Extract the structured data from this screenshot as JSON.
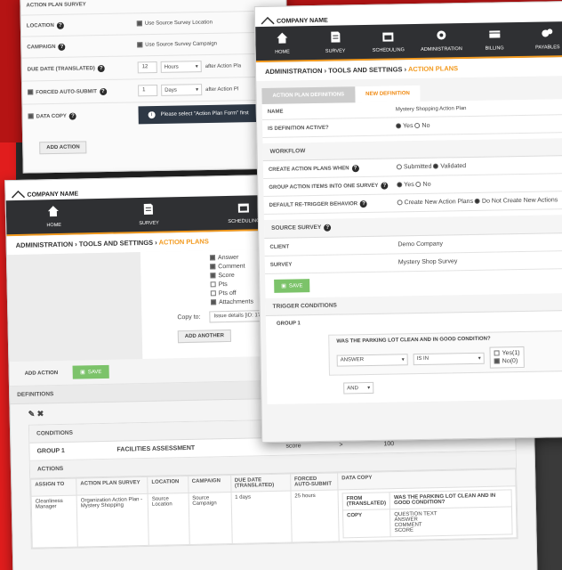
{
  "brand": "COMPANY NAME",
  "nav": [
    "HOME",
    "SURVEY",
    "SCHEDULING",
    "ADMINISTRATION",
    "BILLING",
    "PAYABLES"
  ],
  "nav_icons": [
    "home-icon",
    "survey-icon",
    "calendar-icon",
    "gear-icon",
    "billing-icon",
    "payables-icon"
  ],
  "breadcrumb": {
    "a": "ADMINISTRATION",
    "b": "TOOLS AND SETTINGS",
    "c": "ACTION PLANS",
    "sep": "›"
  },
  "w1": {
    "top_label": "ACTION PLAN SURVEY",
    "location_label": "LOCATION",
    "location_check": "Use Source Survey Location",
    "campaign_label": "CAMPAIGN",
    "campaign_check": "Use Source Survey Campaign",
    "due_label": "DUE DATE (TRANSLATED)",
    "due_value": "12",
    "due_unit": "Hours",
    "due_after": "after Action Pla",
    "forced_label": "FORCED AUTO-SUBMIT",
    "forced_value": "1",
    "forced_unit": "Days",
    "forced_after": "after Action Pl",
    "copy_label": "DATA COPY",
    "info": "Please select \"Action Plan Form\" first",
    "add_action": "ADD ACTION"
  },
  "w2": {
    "checks": [
      "Answer",
      "Comment",
      "Score",
      "Pts",
      "Pts off",
      "Attachments"
    ],
    "copy_to_label": "Copy to:",
    "copy_to_value": "Issue details [ID: 1785]",
    "add_another": "ADD ANOTHER",
    "add_action": "ADD ACTION",
    "save": "SAVE",
    "definitions": "DEFINITIONS",
    "conditions": "CONDITIONS",
    "group": "GROUP 1",
    "group_value": "FACILITIES ASSESSMENT",
    "score_label": "score",
    "score_op": ">",
    "score_val": "100",
    "actions": "ACTIONS",
    "headers": [
      "ASSIGN TO",
      "ACTION PLAN SURVEY",
      "LOCATION",
      "CAMPAIGN",
      "DUE DATE (TRANSLATED)",
      "FORCED AUTO-SUBMIT",
      "DATA COPY"
    ],
    "row": {
      "assign": "Cleanliness Manager",
      "survey": "Organization Action Plan - Mystery Shopping",
      "location": "Source Location",
      "campaign": "Source Campaign",
      "due": "1 days",
      "forced": "25 hours",
      "from_label": "FROM (TRANSLATED)",
      "from_value": "WAS THE PARKING LOT CLEAN AND IN GOOD CONDITION?",
      "copy_label": "COPY",
      "copy_value": "QUESTION TEXT\nANSWER\nCOMMENT\nSCORE"
    }
  },
  "w3": {
    "tab_off": "ACTION PLAN DEFINITIONS",
    "tab_on": "NEW DEFINITION",
    "name_label": "NAME",
    "name_value": "Mystery Shopping Action Plan",
    "active_label": "IS DEFINITION ACTIVE?",
    "yes": "Yes",
    "no": "No",
    "workflow": "WORKFLOW",
    "create_label": "CREATE ACTION PLANS WHEN",
    "submitted": "Submitted",
    "validated": "Validated",
    "group_label": "GROUP ACTION ITEMS INTO ONE SURVEY",
    "retrigger_label": "DEFAULT RE-TRIGGER BEHAVIOR",
    "create_new": "Create New Action Plans",
    "do_not": "Do Not Create New Actions",
    "source": "SOURCE SURVEY",
    "client_label": "CLIENT",
    "client_value": "Demo Company",
    "survey_label": "SURVEY",
    "survey_value": "Mystery Shop Survey",
    "save": "SAVE",
    "trigger": "TRIGGER CONDITIONS",
    "group": "GROUP 1",
    "question": "WAS THE PARKING LOT CLEAN AND IN GOOD CONDITION?",
    "answer": "ANSWER",
    "is_in": "IS IN",
    "opt1": "Yes(1)",
    "opt2": "No(0)",
    "and": "AND"
  }
}
